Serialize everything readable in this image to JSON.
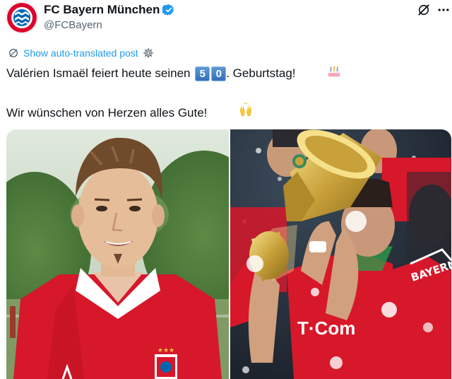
{
  "post": {
    "author": {
      "display_name": "FC Bayern München",
      "handle": "@FCBayern",
      "verified_icon": "verified-badge-icon",
      "avatar_icon": "fc-bayern-crest-icon"
    },
    "actions": {
      "grok_icon": "grok-icon",
      "more_icon": "more-icon"
    },
    "translate": {
      "label": "Show auto-translated post",
      "icon": "translate-icon",
      "settings_icon": "gear-icon"
    },
    "text": {
      "line1_prefix": "Valérien Ismaël feiert heute seinen ",
      "age_digit_1": "5",
      "age_digit_2": "0",
      "line1_suffix": ". Geburtstag!",
      "line1_emoji": "🎂",
      "line2": "Wir wünschen von Herzen alles Gute!",
      "line2_emoji": "🙌"
    },
    "media": {
      "photo_left": "portrait-photo",
      "photo_right": "trophy-celebration-photo",
      "sponsor_text": "T·Com",
      "jersey_text": "BAYERN M"
    }
  },
  "colors": {
    "accent": "#1d9bf0",
    "text": "#0f1419",
    "secondary": "#536471",
    "bayern_red": "#dc052d"
  }
}
